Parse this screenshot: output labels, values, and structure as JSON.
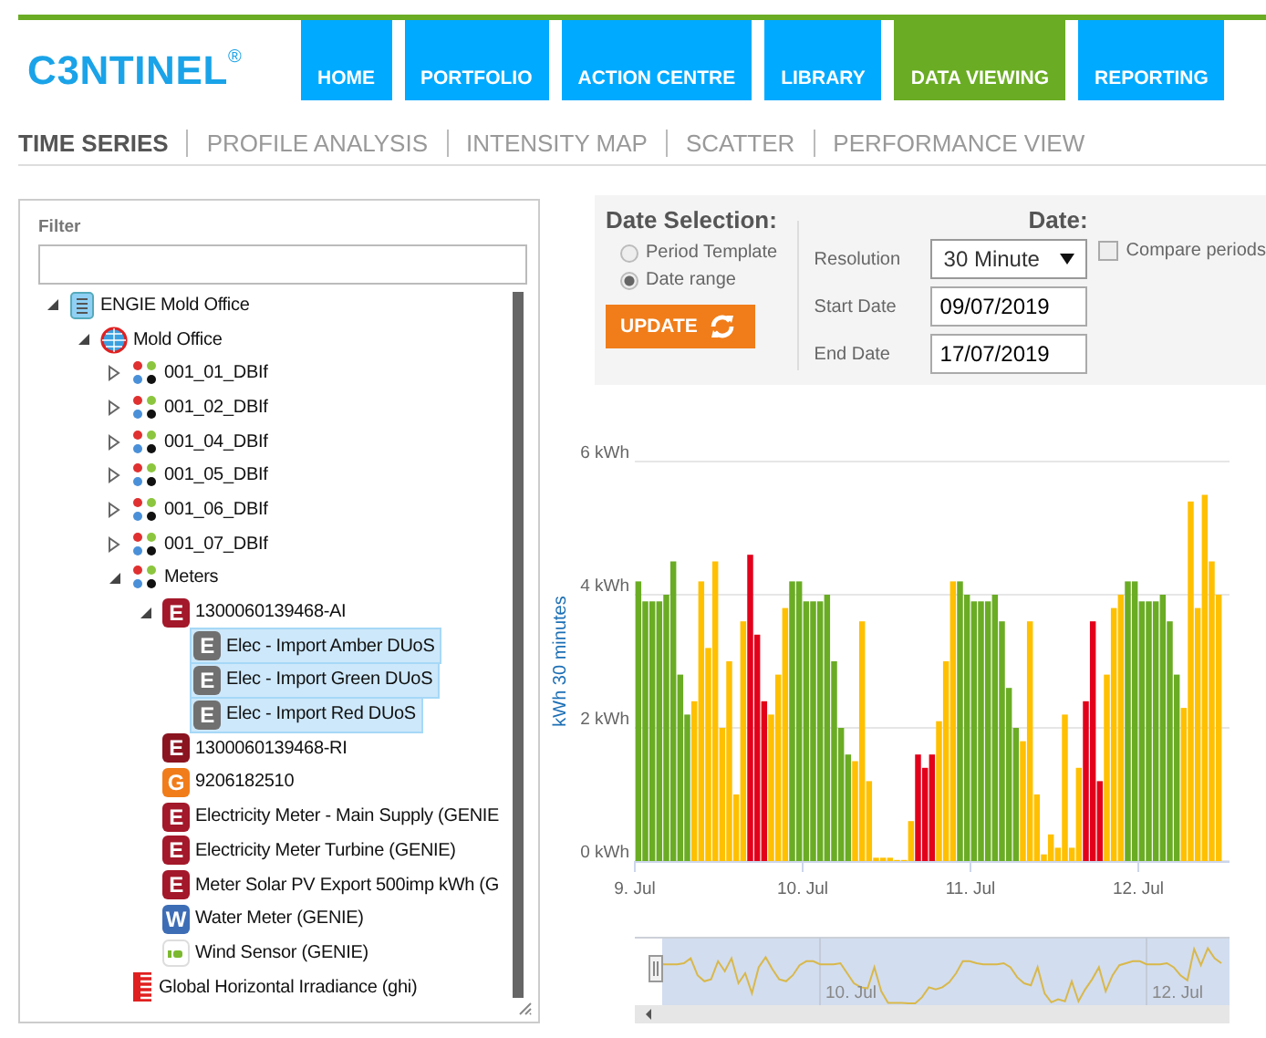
{
  "logo": {
    "text": "C3NTINEL",
    "mark": "®"
  },
  "nav": [
    {
      "label": "HOME",
      "selected": false
    },
    {
      "label": "PORTFOLIO",
      "selected": false
    },
    {
      "label": "ACTION CENTRE",
      "selected": false
    },
    {
      "label": "LIBRARY",
      "selected": false
    },
    {
      "label": "DATA VIEWING",
      "selected": true
    },
    {
      "label": "REPORTING",
      "selected": false
    }
  ],
  "subnav": [
    {
      "label": "TIME SERIES",
      "selected": true
    },
    {
      "label": "PROFILE ANALYSIS",
      "selected": false
    },
    {
      "label": "INTENSITY MAP",
      "selected": false
    },
    {
      "label": "SCATTER",
      "selected": false
    },
    {
      "label": "PERFORMANCE VIEW",
      "selected": false
    }
  ],
  "filter": {
    "label": "Filter"
  },
  "tree": [
    {
      "label": "ENGIE Mold Office",
      "kind": "building",
      "expanded": true,
      "selected": false,
      "children": [
        {
          "label": "Mold Office",
          "kind": "site",
          "expanded": true,
          "selected": false,
          "children": [
            {
              "label": "001_01_DBIf",
              "kind": "group",
              "expanded": false,
              "selected": false
            },
            {
              "label": "001_02_DBIf",
              "kind": "group",
              "expanded": false,
              "selected": false
            },
            {
              "label": "001_04_DBIf",
              "kind": "group",
              "expanded": false,
              "selected": false
            },
            {
              "label": "001_05_DBIf",
              "kind": "group",
              "expanded": false,
              "selected": false
            },
            {
              "label": "001_06_DBIf",
              "kind": "group",
              "expanded": false,
              "selected": false
            },
            {
              "label": "001_07_DBIf",
              "kind": "group",
              "expanded": false,
              "selected": false
            },
            {
              "label": "Meters",
              "kind": "group",
              "expanded": true,
              "selected": false,
              "children": [
                {
                  "label": "1300060139468-AI",
                  "kind": "meter",
                  "badge": "E",
                  "color": "#a3182a",
                  "expanded": true,
                  "selected": false,
                  "children": [
                    {
                      "label": "Elec - Import Amber DUoS",
                      "kind": "meter",
                      "badge": "E",
                      "color": "#707070",
                      "selected": true
                    },
                    {
                      "label": "Elec - Import Green DUoS",
                      "kind": "meter",
                      "badge": "E",
                      "color": "#707070",
                      "selected": true
                    },
                    {
                      "label": "Elec - Import Red DUoS",
                      "kind": "meter",
                      "badge": "E",
                      "color": "#707070",
                      "selected": true
                    }
                  ]
                },
                {
                  "label": "1300060139468-RI",
                  "kind": "meter",
                  "badge": "E",
                  "color": "#8a1420",
                  "selected": false
                },
                {
                  "label": "9206182510",
                  "kind": "meter",
                  "badge": "G",
                  "color": "#f07d1a",
                  "selected": false
                },
                {
                  "label": "Electricity Meter - Main Supply (GENIE",
                  "kind": "meter",
                  "badge": "E",
                  "color": "#a3182a",
                  "selected": false
                },
                {
                  "label": "Electricity Meter Turbine (GENIE)",
                  "kind": "meter",
                  "badge": "E",
                  "color": "#a3182a",
                  "selected": false
                },
                {
                  "label": "Meter Solar PV Export 500imp kWh (G",
                  "kind": "meter",
                  "badge": "E",
                  "color": "#a3182a",
                  "selected": false
                },
                {
                  "label": "Water Meter (GENIE)",
                  "kind": "meter",
                  "badge": "W",
                  "color": "#3d6db5",
                  "selected": false
                },
                {
                  "label": "Wind Sensor (GENIE)",
                  "kind": "sensor",
                  "selected": false
                }
              ]
            },
            {
              "label": "Global Horizontal Irradiance (ghi)",
              "kind": "irradiance",
              "selected": false
            }
          ]
        }
      ]
    }
  ],
  "date_selection": {
    "title": "Date Selection:",
    "options": [
      {
        "label": "Period Template",
        "selected": false
      },
      {
        "label": "Date range",
        "selected": true
      }
    ],
    "update_button": "UPDATE"
  },
  "date": {
    "title": "Date:",
    "resolution_label": "Resolution",
    "resolution": "30 Minute",
    "start_label": "Start Date",
    "start": "09/07/2019",
    "end_label": "End Date",
    "end": "17/07/2019",
    "compare": {
      "label": "Compare periods",
      "checked": false
    }
  },
  "chart": {
    "chart_data": {
      "type": "bar",
      "ylabel": "kWh 30 minutes",
      "stacked": true,
      "ylim": [
        0,
        6
      ],
      "yticks": [
        {
          "value": 0,
          "label": "0 kWh"
        },
        {
          "value": 2,
          "label": "2 kWh"
        },
        {
          "value": 4,
          "label": "4 kWh"
        },
        {
          "value": 6,
          "label": "6 kWh"
        }
      ],
      "categories": [
        "9. Jul",
        null,
        null,
        null,
        null,
        null,
        null,
        null,
        null,
        null,
        null,
        null,
        null,
        null,
        null,
        null,
        null,
        null,
        null,
        null,
        null,
        null,
        null,
        null,
        "10. Jul",
        null,
        null,
        null,
        null,
        null,
        null,
        null,
        null,
        null,
        null,
        null,
        null,
        null,
        null,
        null,
        null,
        null,
        null,
        null,
        null,
        null,
        null,
        null,
        "11. Jul",
        null,
        null,
        null,
        null,
        null,
        null,
        null,
        null,
        null,
        null,
        null,
        null,
        null,
        null,
        null,
        null,
        null,
        null,
        null,
        null,
        null,
        null,
        null,
        "12. Jul",
        null,
        null,
        null,
        null,
        null,
        null,
        null,
        null,
        null,
        null,
        null
      ],
      "series": [
        {
          "color": "#6aac24",
          "values": [
            4.2,
            3.9,
            3.9,
            3.9,
            4.0,
            4.5,
            2.8,
            2.2,
            null,
            null,
            null,
            null,
            null,
            null,
            null,
            null,
            null,
            null,
            null,
            null,
            null,
            null,
            4.2,
            4.2,
            3.9,
            3.9,
            3.9,
            4.0,
            3.0,
            2.0,
            1.6,
            null,
            null,
            null,
            null,
            null,
            null,
            null,
            null,
            null,
            null,
            null,
            null,
            null,
            null,
            null,
            4.2,
            4.0,
            3.9,
            3.9,
            3.9,
            4.0,
            3.6,
            2.6,
            2.0,
            null,
            null,
            null,
            null,
            null,
            null,
            null,
            null,
            null,
            null,
            null,
            null,
            null,
            null,
            null,
            4.2,
            4.2,
            3.9,
            3.9,
            3.9,
            4.0,
            3.6,
            2.8,
            null,
            null,
            null,
            null,
            null,
            null
          ]
        },
        {
          "color": "#ffc000",
          "values": [
            null,
            null,
            null,
            null,
            null,
            null,
            null,
            null,
            2.4,
            4.2,
            3.2,
            4.5,
            2.0,
            3.0,
            1.0,
            3.6,
            null,
            null,
            null,
            2.2,
            2.8,
            3.8,
            null,
            null,
            null,
            null,
            null,
            null,
            null,
            null,
            null,
            1.5,
            3.6,
            1.2,
            0.05,
            0.05,
            0.05,
            0,
            0,
            0.6,
            null,
            null,
            null,
            2.1,
            3.0,
            4.2,
            null,
            null,
            null,
            null,
            null,
            null,
            null,
            null,
            null,
            1.8,
            3.6,
            1.0,
            0.1,
            0.4,
            0.2,
            2.2,
            0.2,
            1.4,
            null,
            null,
            null,
            2.8,
            3.8,
            4.0,
            null,
            null,
            null,
            null,
            null,
            null,
            null,
            null,
            2.3,
            5.4,
            3.8,
            5.5,
            4.5,
            4.0
          ]
        },
        {
          "color": "#e2001a",
          "values": [
            null,
            null,
            null,
            null,
            null,
            null,
            null,
            null,
            null,
            null,
            null,
            null,
            null,
            null,
            null,
            null,
            4.6,
            3.4,
            2.4,
            null,
            null,
            null,
            null,
            null,
            null,
            null,
            null,
            null,
            null,
            null,
            null,
            null,
            null,
            null,
            null,
            null,
            null,
            null,
            null,
            null,
            1.6,
            1.4,
            1.6,
            null,
            null,
            null,
            null,
            null,
            null,
            null,
            null,
            null,
            null,
            null,
            null,
            null,
            null,
            null,
            null,
            null,
            null,
            null,
            null,
            null,
            2.4,
            3.6,
            1.2,
            null,
            null,
            null,
            null,
            null,
            null,
            null,
            null,
            null,
            null,
            null,
            null,
            null,
            null,
            null,
            null,
            null
          ]
        }
      ]
    }
  },
  "navigator": {
    "labels": [
      "10. Jul",
      "12. Jul"
    ]
  }
}
